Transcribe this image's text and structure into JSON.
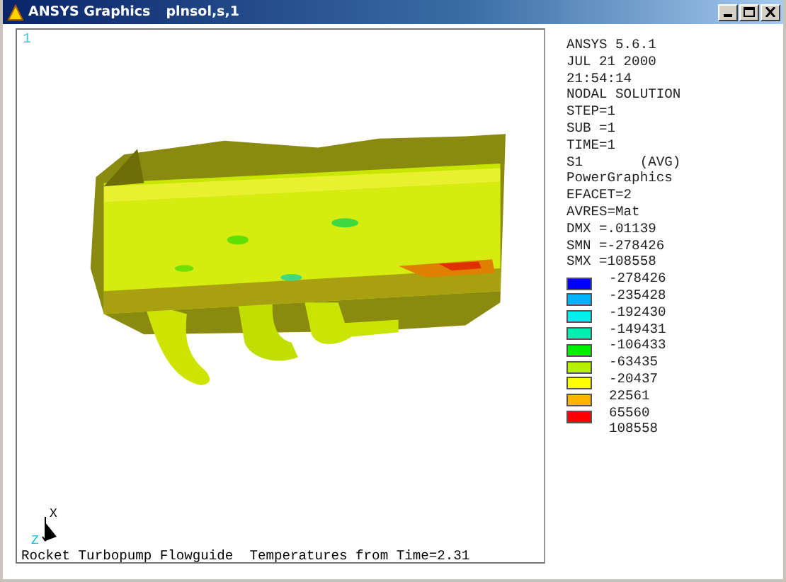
{
  "window": {
    "title": "ANSYS Graphics",
    "command": "plnsol,s,1"
  },
  "viewport": {
    "window_number": "1",
    "triad": {
      "x_label": "X",
      "z_label": "Z"
    },
    "caption": "Rocket Turbopump Flowguide  Temperatures from Time=2.31"
  },
  "info": [
    "ANSYS 5.6.1",
    "JUL 21 2000",
    "21:54:14",
    "NODAL SOLUTION",
    "STEP=1",
    "SUB =1",
    "TIME=1",
    "S1       (AVG)",
    "PowerGraphics",
    "EFACET=2",
    "AVRES=Mat",
    "DMX =.01139",
    "SMN =-278426",
    "SMX =108558"
  ],
  "legend": [
    {
      "value": "-278426",
      "color": "#0000ff"
    },
    {
      "value": "-235428",
      "color": "#00b4ff"
    },
    {
      "value": "-192430",
      "color": "#00f0f0"
    },
    {
      "value": "-149431",
      "color": "#00f0b4"
    },
    {
      "value": "-106433",
      "color": "#00f000"
    },
    {
      "value": "-63435",
      "color": "#b4f000"
    },
    {
      "value": "-20437",
      "color": "#ffff00"
    },
    {
      "value": "22561",
      "color": "#ffb400"
    },
    {
      "value": "65560",
      "color": "#ff0000"
    }
  ],
  "legend_max": "108558"
}
